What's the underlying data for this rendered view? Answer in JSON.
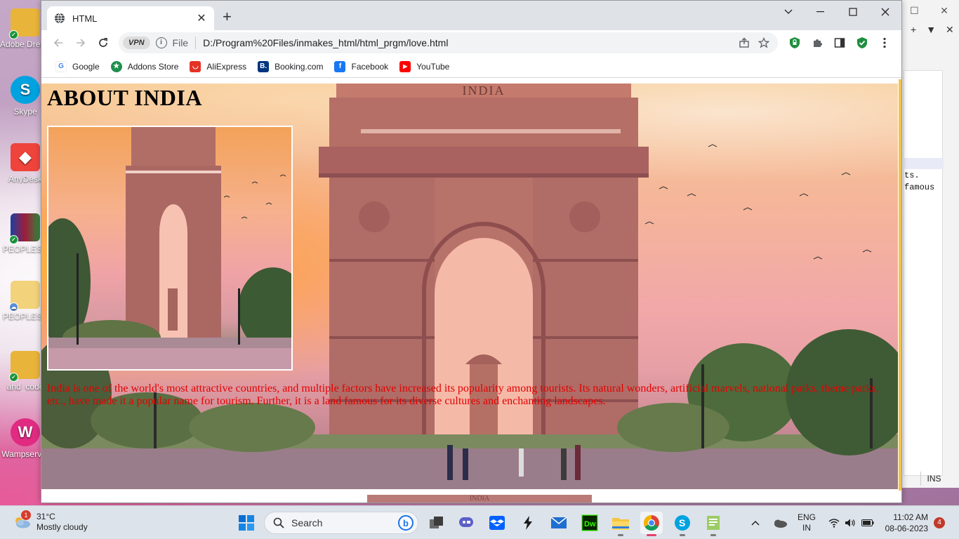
{
  "desktop": {
    "icons": [
      {
        "label": "Adobe Dreamweaver",
        "color": "#e0a01a",
        "glyph": ""
      },
      {
        "label": "Skype",
        "color": "#00a3e0",
        "glyph": "S"
      },
      {
        "label": "AnyDesk",
        "color": "#ef443b",
        "glyph": "◆"
      },
      {
        "label": "PEOPLESV",
        "color": "#7a1d2e",
        "glyph": ""
      },
      {
        "label": "PEOPLESV",
        "color": "#e9c46a",
        "glyph": ""
      },
      {
        "label": "and_code",
        "color": "#e0a01a",
        "glyph": ""
      },
      {
        "label": "Wampserver",
        "color": "#e12b82",
        "glyph": "W"
      }
    ]
  },
  "browser": {
    "tab_title": "HTML",
    "omnibox": {
      "vpn_label": "VPN",
      "file_label": "File",
      "url": "D:/Program%20Files/inmakes_html/html_prgm/love.html"
    },
    "bookmarks": [
      {
        "label": "Google",
        "color": "#ffffff",
        "glyph": "G"
      },
      {
        "label": "Addons Store",
        "color": "#1f8f4e",
        "glyph": "★"
      },
      {
        "label": "AliExpress",
        "color": "#e43225",
        "glyph": "◡"
      },
      {
        "label": "Booking.com",
        "color": "#003580",
        "glyph": "B."
      },
      {
        "label": "Facebook",
        "color": "#1877f2",
        "glyph": "f"
      },
      {
        "label": "YouTube",
        "color": "#ff0000",
        "glyph": "▶"
      }
    ]
  },
  "page": {
    "heading": "ABOUT INDIA",
    "monument_inscription": "INDIA",
    "paragraph": "India is one of the world's most attractive countries, and multiple factors have increased its popularity among tourists. Its natural wonders, artificial marvels, national parks, theme parks, etc., have made it a popular name for tourism. Further, it is a land famous for its diverse cultures and enchanting landscapes.",
    "paragraph_color": "#e40000"
  },
  "bg_window": {
    "toolbar_plus": "+",
    "toolbar_down": "▼",
    "toolbar_close": "✕",
    "editor_line1": "ts.",
    "editor_line2": "famous",
    "status_mode": "INS"
  },
  "taskbar": {
    "weather_temp": "31°C",
    "weather_desc": "Mostly cloudy",
    "weather_badge": "1",
    "search_label": "Search",
    "language_top": "ENG",
    "language_bottom": "IN",
    "time": "11:02 AM",
    "date": "08-06-2023",
    "notification_count": "4"
  }
}
